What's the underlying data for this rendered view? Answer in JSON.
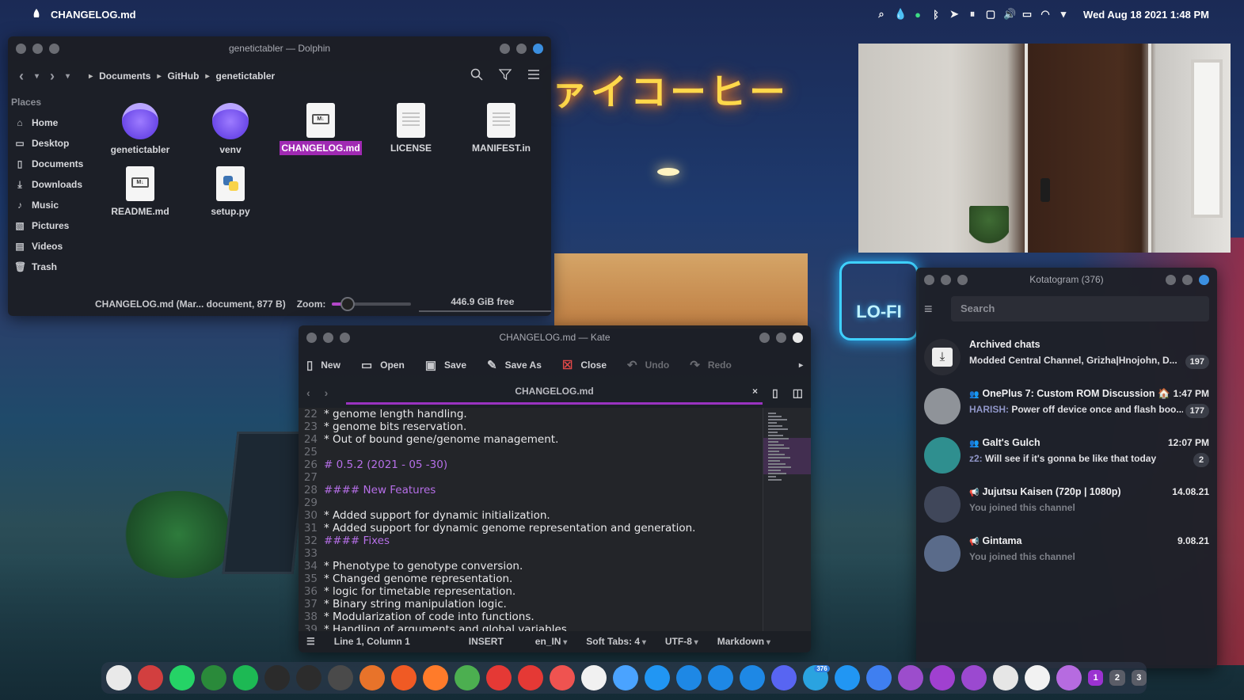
{
  "topbar": {
    "active_app": "CHANGELOG.md",
    "clock": "Wed Aug 18 2021  1:48 PM",
    "tray_icons": [
      "search-icon",
      "drop-icon",
      "status-icon",
      "bluetooth-icon",
      "telegram-icon",
      "pause-icon",
      "clipboard-icon",
      "volume-icon",
      "battery-icon",
      "wifi-icon",
      "chevron-down-icon"
    ]
  },
  "wallpaper": {
    "sign_text": "ァイコーヒー",
    "neon_text": "LO-FI"
  },
  "dolphin": {
    "title": "genetictabler — Dolphin",
    "breadcrumb": [
      "Documents",
      "GitHub",
      "genetictabler"
    ],
    "places_header": "Places",
    "places": [
      {
        "label": "Home",
        "icon": "home-icon"
      },
      {
        "label": "Desktop",
        "icon": "desktop-icon"
      },
      {
        "label": "Documents",
        "icon": "document-icon"
      },
      {
        "label": "Downloads",
        "icon": "download-icon"
      },
      {
        "label": "Music",
        "icon": "music-icon"
      },
      {
        "label": "Pictures",
        "icon": "picture-icon"
      },
      {
        "label": "Videos",
        "icon": "video-icon"
      },
      {
        "label": "Trash",
        "icon": "trash-icon"
      }
    ],
    "files": [
      {
        "name": "genetictabler",
        "type": "folder"
      },
      {
        "name": "venv",
        "type": "folder"
      },
      {
        "name": "CHANGELOG.md",
        "type": "markdown",
        "selected": true
      },
      {
        "name": "LICENSE",
        "type": "text"
      },
      {
        "name": "MANIFEST.in",
        "type": "text"
      },
      {
        "name": "README.md",
        "type": "markdown"
      },
      {
        "name": "setup.py",
        "type": "python"
      }
    ],
    "status_text": "CHANGELOG.md (Mar... document, 877 B)",
    "zoom_label": "Zoom:",
    "zoom_level": 0.2,
    "free_space": "446.9 GiB free"
  },
  "kate": {
    "title": "CHANGELOG.md — Kate",
    "toolbar": [
      {
        "label": "New",
        "icon": "new-file-icon",
        "enabled": true
      },
      {
        "label": "Open",
        "icon": "folder-open-icon",
        "enabled": true
      },
      {
        "label": "Save",
        "icon": "save-icon",
        "enabled": true
      },
      {
        "label": "Save As",
        "icon": "save-as-icon",
        "enabled": true
      },
      {
        "label": "Close",
        "icon": "close-file-icon",
        "enabled": true
      },
      {
        "label": "Undo",
        "icon": "undo-icon",
        "enabled": false
      },
      {
        "label": "Redo",
        "icon": "redo-icon",
        "enabled": false
      }
    ],
    "tab_label": "CHANGELOG.md",
    "lines": [
      {
        "n": "22",
        "text": "* genome length handling.",
        "heading": false
      },
      {
        "n": "23",
        "text": "* genome bits reservation.",
        "heading": false
      },
      {
        "n": "24",
        "text": "* Out of bound gene/genome management.",
        "heading": false
      },
      {
        "n": "25",
        "text": "",
        "heading": false
      },
      {
        "n": "26",
        "text": "# 0.5.2 (2021 - 05 -30)",
        "heading": true
      },
      {
        "n": "27",
        "text": "",
        "heading": false
      },
      {
        "n": "28",
        "text": "#### New Features",
        "heading": true
      },
      {
        "n": "29",
        "text": "",
        "heading": false
      },
      {
        "n": "30",
        "text": "* Added support for dynamic initialization.",
        "heading": false
      },
      {
        "n": "31",
        "text": "* Added support for dynamic genome representation and generation.",
        "heading": false
      },
      {
        "n": "32",
        "text": "#### Fixes",
        "heading": true
      },
      {
        "n": "33",
        "text": "",
        "heading": false
      },
      {
        "n": "34",
        "text": "* Phenotype to genotype conversion.",
        "heading": false
      },
      {
        "n": "35",
        "text": "* Changed genome representation.",
        "heading": false
      },
      {
        "n": "36",
        "text": "* logic for timetable representation.",
        "heading": false
      },
      {
        "n": "37",
        "text": "* Binary string manipulation logic.",
        "heading": false
      },
      {
        "n": "38",
        "text": "* Modularization of code into functions.",
        "heading": false
      },
      {
        "n": "39",
        "text": "* Handling of arguments and global variables",
        "heading": false
      }
    ],
    "status": {
      "cursor": "Line 1, Column 1",
      "mode": "INSERT",
      "dictionary": "en_IN",
      "indent": "Soft Tabs: 4",
      "encoding": "UTF-8",
      "syntax": "Markdown"
    }
  },
  "telegram": {
    "title": "Kotatogram (376)",
    "search_placeholder": "Search",
    "chats": [
      {
        "name": "Archived chats",
        "sender": "",
        "preview": "Modded Central Channel, Grizha|Hnojohn, D...",
        "time": "",
        "badge": "197",
        "avatar": "archive-icon",
        "kind": "archive"
      },
      {
        "name": "OnePlus 7: Custom ROM Discussion 🏠",
        "sender": "HARISH:",
        "preview": " Power off device once and flash boo...",
        "time": "1:47 PM",
        "badge": "177",
        "avatar": "oneplus-avatar",
        "kind": "group"
      },
      {
        "name": "Galt's Gulch",
        "sender": "z2:",
        "preview": " Will see if it's gonna be like that today",
        "time": "12:07 PM",
        "badge": "2",
        "avatar": "galts-gulch-avatar",
        "kind": "group"
      },
      {
        "name": "Jujutsu Kaisen (720p | 1080p)",
        "sender": "",
        "preview": "You joined this channel",
        "time": "14.08.21",
        "badge": "",
        "avatar": "jujutsu-avatar",
        "kind": "channel"
      },
      {
        "name": "Gintama",
        "sender": "",
        "preview": "You joined this channel",
        "time": "9.08.21",
        "badge": "",
        "avatar": "gintama-avatar",
        "kind": "channel"
      }
    ]
  },
  "dock": {
    "apps": [
      {
        "name": "toggle-app",
        "color": "#e9e9e9"
      },
      {
        "name": "chrome-canary",
        "color": "#d23f3f"
      },
      {
        "name": "whatsapp",
        "color": "#25d366"
      },
      {
        "name": "vim",
        "color": "#2a8a3a"
      },
      {
        "name": "spotify",
        "color": "#1db954"
      },
      {
        "name": "pycharm",
        "color": "#2b2b2b"
      },
      {
        "name": "terminal",
        "color": "#2c2c2c"
      },
      {
        "name": "sublime-text",
        "color": "#4a4a4a"
      },
      {
        "name": "headphones",
        "color": "#e8732a"
      },
      {
        "name": "brave",
        "color": "#f05a24"
      },
      {
        "name": "firefox",
        "color": "#ff7b2a"
      },
      {
        "name": "chrome",
        "color": "#4caf50"
      },
      {
        "name": "feather",
        "color": "#e53935"
      },
      {
        "name": "youtube",
        "color": "#e53935"
      },
      {
        "name": "anydesk",
        "color": "#ef5350"
      },
      {
        "name": "calendar",
        "color": "#f1f1f1"
      },
      {
        "name": "finder",
        "color": "#4aa3ff"
      },
      {
        "name": "drop-app",
        "color": "#2196f3"
      },
      {
        "name": "sync-app",
        "color": "#1e88e5"
      },
      {
        "name": "writer",
        "color": "#1e88e5"
      },
      {
        "name": "recycle",
        "color": "#1e88e5"
      },
      {
        "name": "discord",
        "color": "#5865f2"
      },
      {
        "name": "telegram",
        "color": "#2aa3e0",
        "badge": "376"
      },
      {
        "name": "calculator",
        "color": "#2196f3"
      },
      {
        "name": "media-player",
        "color": "#3f7ff0"
      },
      {
        "name": "screenshot",
        "color": "#9c4dcc"
      },
      {
        "name": "typora",
        "color": "#a040d0"
      },
      {
        "name": "github",
        "color": "#9b49d0"
      },
      {
        "name": "vscode",
        "color": "#e6e6e6"
      },
      {
        "name": "xcode",
        "color": "#f2f2f2"
      },
      {
        "name": "trash",
        "color": "#b66be0"
      }
    ],
    "workspaces": [
      "1",
      "2",
      "3"
    ]
  }
}
